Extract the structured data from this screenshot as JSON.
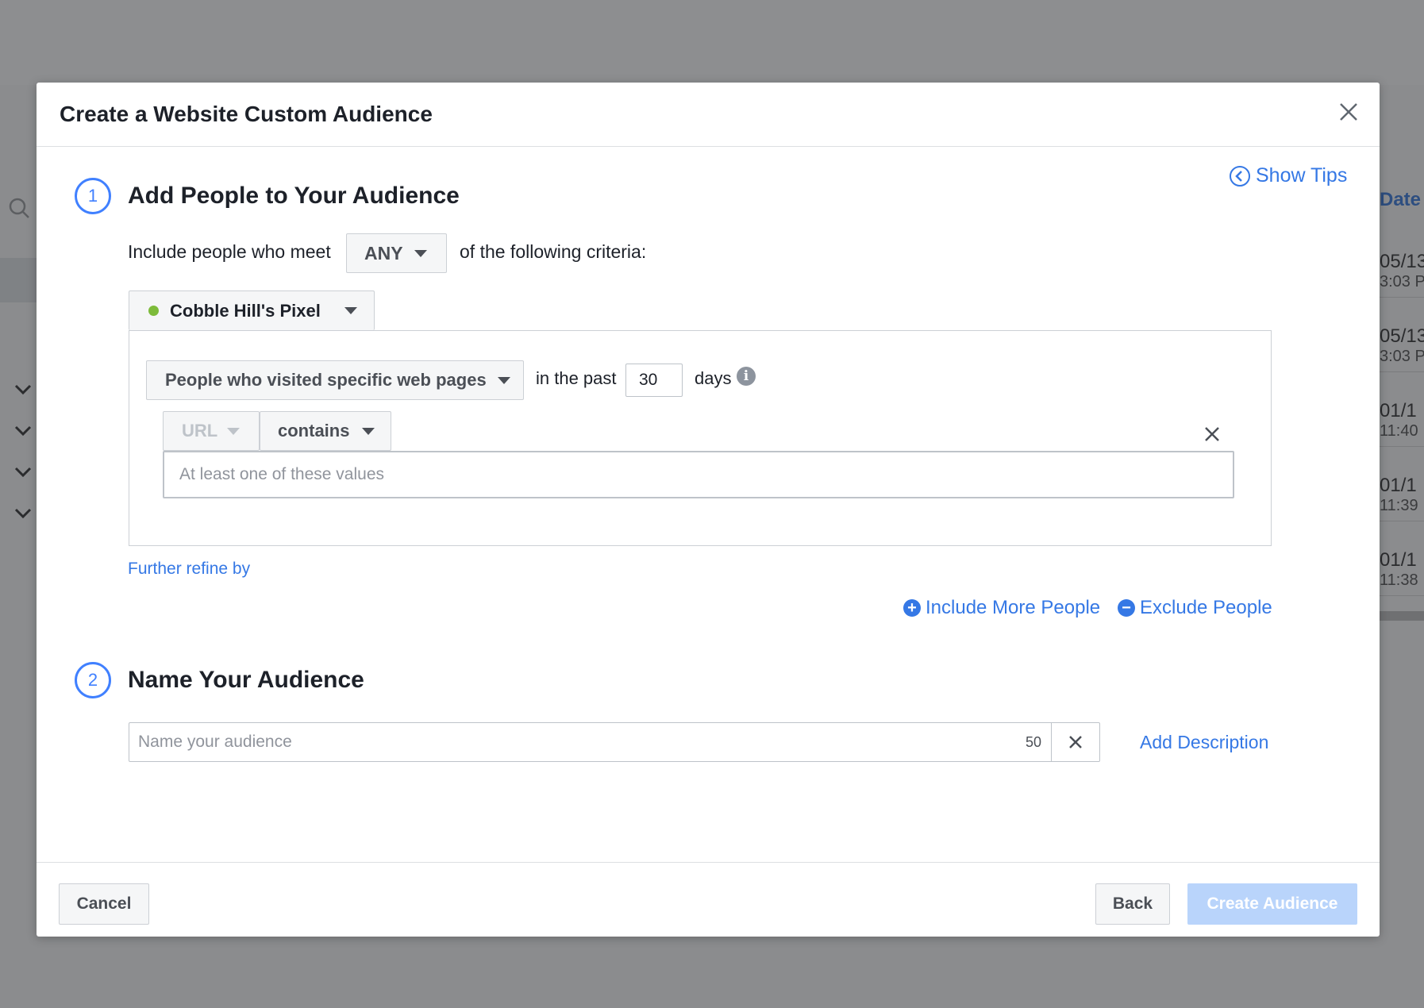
{
  "background": {
    "date_header": "Date",
    "rows": [
      {
        "date": "05/13",
        "time": "3:03 P"
      },
      {
        "date": "05/13",
        "time": "3:03 P"
      },
      {
        "date": "01/1",
        "time": "11:40"
      },
      {
        "date": "01/1",
        "time": "11:39"
      },
      {
        "date": "01/1",
        "time": "11:38"
      }
    ]
  },
  "modal": {
    "title": "Create a Website Custom Audience",
    "show_tips": "Show Tips",
    "step1": {
      "number": "1",
      "title": "Add People to Your Audience",
      "include_prefix": "Include people who meet",
      "match_value": "ANY",
      "include_suffix": "of the following criteria:",
      "pixel_name": "Cobble Hill's Pixel",
      "rule_type": "People who visited specific web pages",
      "in_the_past": "in the past",
      "days_value": "30",
      "days_label": "days",
      "url_field": "URL",
      "operator": "contains",
      "values_placeholder": "At least one of these values",
      "refine_link": "Further refine by",
      "include_more": "Include More People",
      "exclude": "Exclude People"
    },
    "step2": {
      "number": "2",
      "title": "Name Your Audience",
      "name_placeholder": "Name your audience",
      "char_count": "50",
      "add_description": "Add Description"
    },
    "footer": {
      "cancel": "Cancel",
      "back": "Back",
      "create": "Create Audience"
    }
  },
  "colors": {
    "accent": "#3578e5",
    "step_circle": "#4080ff",
    "pixel_status": "#7dbb3a",
    "primary_disabled": "#b9d4fb"
  },
  "icons": [
    "close-icon",
    "chevron-left-icon",
    "info-icon",
    "plus-circle-icon",
    "minus-circle-icon",
    "caret-down-icon",
    "search-icon"
  ]
}
